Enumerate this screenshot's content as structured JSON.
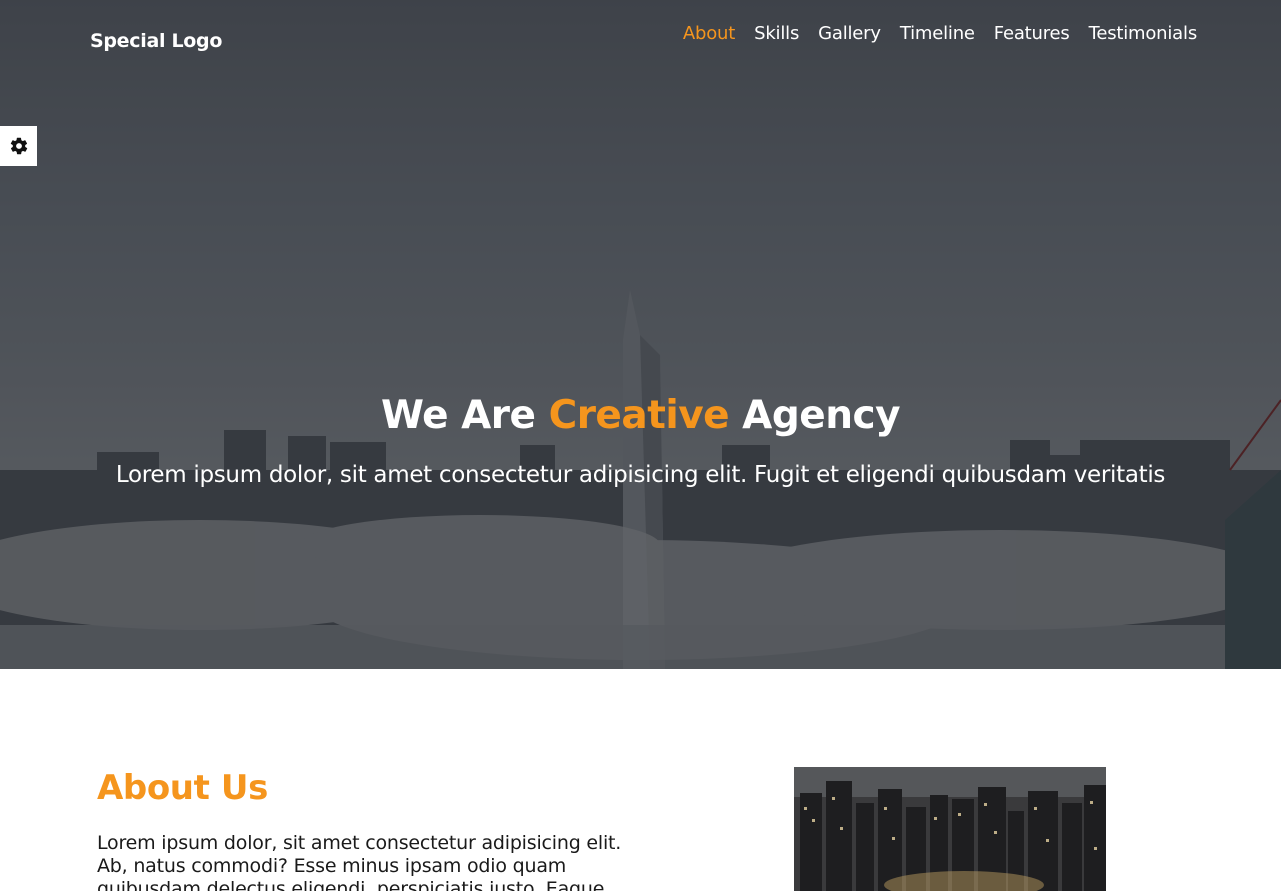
{
  "header": {
    "logo": "Special Logo",
    "nav": [
      {
        "label": "About",
        "active": true
      },
      {
        "label": "Skills",
        "active": false
      },
      {
        "label": "Gallery",
        "active": false
      },
      {
        "label": "Timeline",
        "active": false
      },
      {
        "label": "Features",
        "active": false
      },
      {
        "label": "Testimonials",
        "active": false
      }
    ]
  },
  "settings": {
    "icon": "gear-icon"
  },
  "hero": {
    "title_before": "We Are ",
    "title_accent": "Creative",
    "title_after": " Agency",
    "subtitle": "Lorem ipsum dolor, sit amet consectetur adipisicing elit. Fugit et eligendi quibusdam veritatis"
  },
  "about": {
    "heading": "About Us",
    "text": "Lorem ipsum dolor, sit amet consectetur adipisicing elit. Ab, natus commodi? Esse minus ipsam odio quam quibusdam delectus eligendi, perspiciatis iusto. Eaque"
  },
  "colors": {
    "accent": "#f5951d",
    "text": "#1a1a1a",
    "overlay": "#14161a"
  }
}
